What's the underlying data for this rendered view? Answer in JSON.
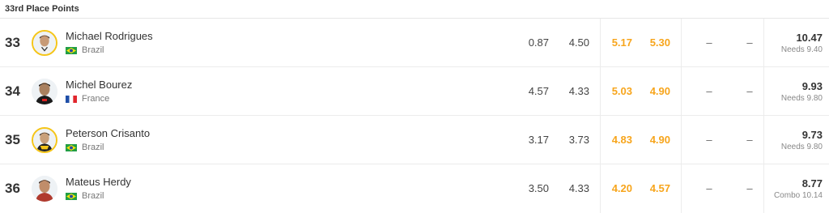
{
  "header": {
    "title": "33rd Place Points"
  },
  "colors": {
    "highlight": "#f7a51c",
    "avatar_ring": "#f5c518"
  },
  "rows": [
    {
      "rank": "33",
      "name": "Michael Rodrigues",
      "country": "Brazil",
      "flag": "brazil-flag-icon",
      "scores": [
        "0.87",
        "4.50",
        "5.17",
        "5.30"
      ],
      "extra": [
        "–",
        "–"
      ],
      "total": "10.47",
      "need": "Needs 9.40"
    },
    {
      "rank": "34",
      "name": "Michel Bourez",
      "country": "France",
      "flag": "france-flag-icon",
      "scores": [
        "4.57",
        "4.33",
        "5.03",
        "4.90"
      ],
      "extra": [
        "–",
        "–"
      ],
      "total": "9.93",
      "need": "Needs 9.80"
    },
    {
      "rank": "35",
      "name": "Peterson Crisanto",
      "country": "Brazil",
      "flag": "brazil-flag-icon",
      "scores": [
        "3.17",
        "3.73",
        "4.83",
        "4.90"
      ],
      "extra": [
        "–",
        "–"
      ],
      "total": "9.73",
      "need": "Needs 9.80"
    },
    {
      "rank": "36",
      "name": "Mateus Herdy",
      "country": "Brazil",
      "flag": "brazil-flag-icon",
      "scores": [
        "3.50",
        "4.33",
        "4.20",
        "4.57"
      ],
      "extra": [
        "–",
        "–"
      ],
      "total": "8.77",
      "need": "Combo 10.14"
    }
  ]
}
